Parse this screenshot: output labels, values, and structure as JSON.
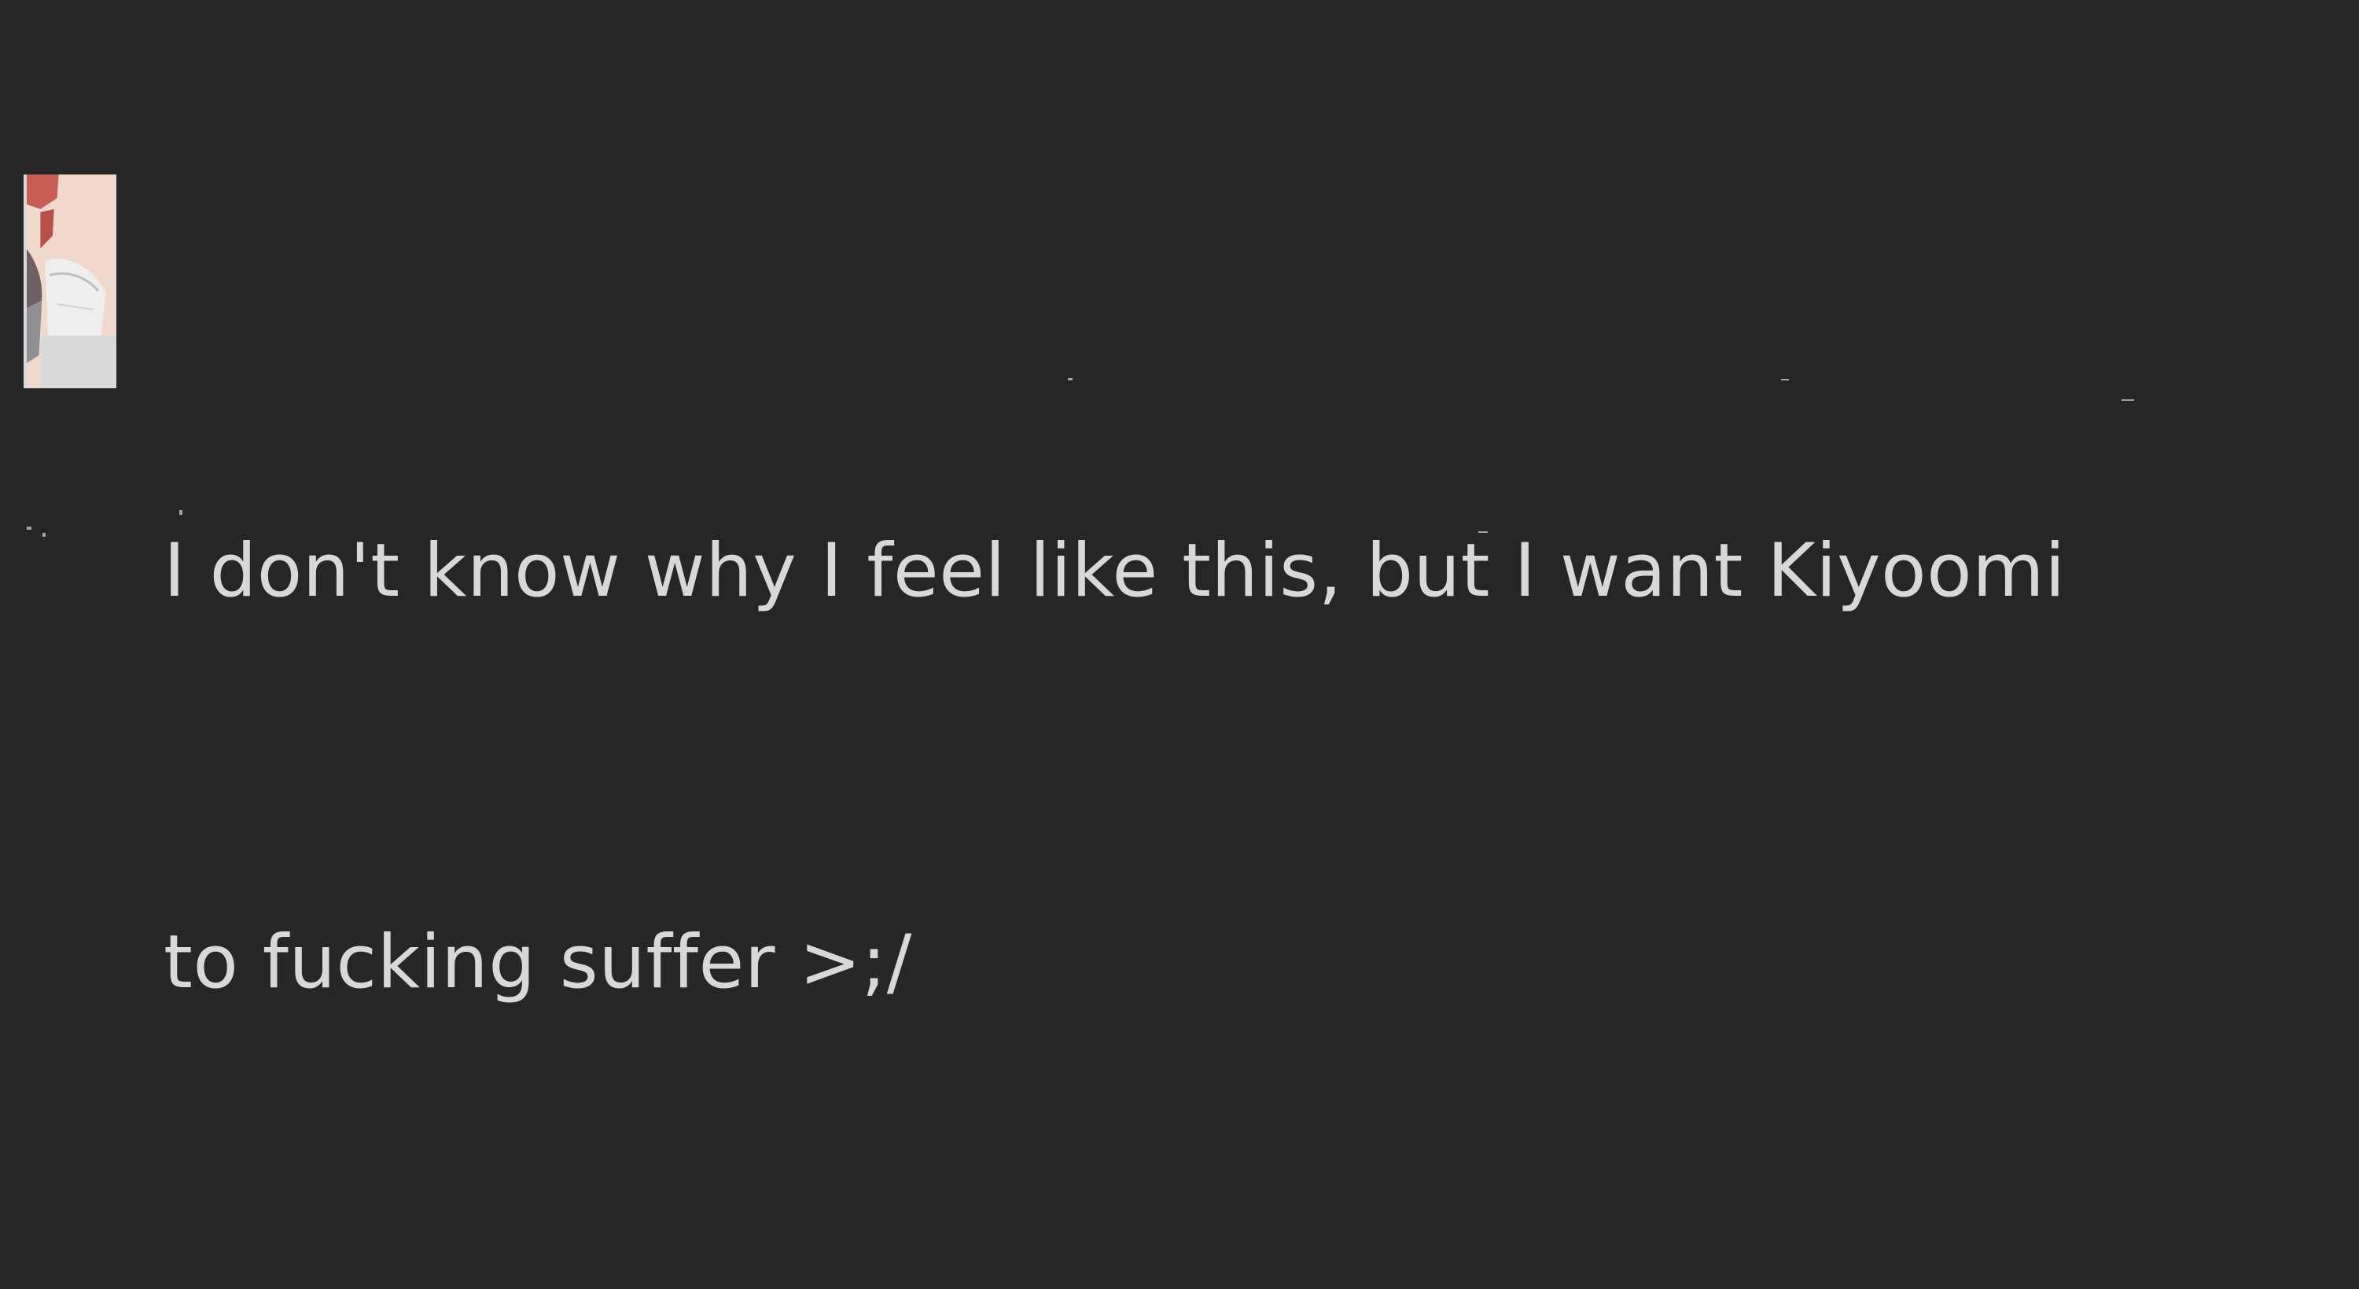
{
  "message": {
    "avatar_icon": "user-avatar-icon",
    "lines": [
      "I don't know why I feel like this, but I want Kiyoomi",
      "to fucking suffer >;/"
    ]
  },
  "colors": {
    "background": "#262626",
    "text": "#d8d8d8"
  }
}
